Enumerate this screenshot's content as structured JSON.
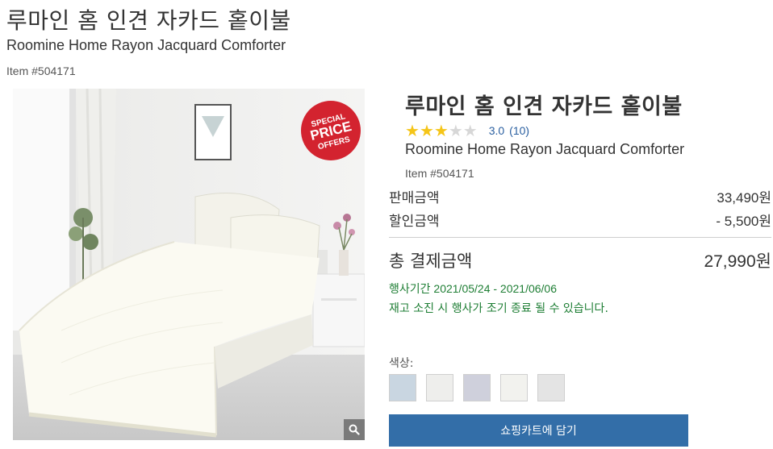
{
  "header": {
    "title": "루마인 홈 인견 자카드 홑이불",
    "subtitle": "Roomine Home Rayon Jacquard Comforter",
    "item_number": "Item #504171"
  },
  "image": {
    "badge_line1": "SPECIAL",
    "badge_line2": "PRICE",
    "badge_line3": "OFFERS",
    "zoom_icon": "magnifier-icon"
  },
  "product": {
    "title": "루마인 홈 인견 자카드 홑이불",
    "rating_value": 3.0,
    "rating_score_text": "3.0",
    "rating_count_text": "(10)",
    "subtitle": "Roomine Home Rayon Jacquard Comforter",
    "item_number": "Item #504171"
  },
  "pricing": {
    "sale_label": "판매금액",
    "sale_value": "33,490원",
    "discount_label": "할인금액",
    "discount_value": "- 5,500원",
    "total_label": "총 결제금액",
    "total_value": "27,990원"
  },
  "event": {
    "period": "행사기간 2021/05/24 - 2021/06/06",
    "note": "재고 소진 시 행사가 조기 종료 될 수 있습니다."
  },
  "colors": {
    "label": "색상:",
    "swatches": [
      "#c9d6e1",
      "#eeeeec",
      "#cfd0dc",
      "#f2f2ee",
      "#e4e4e4"
    ]
  },
  "cart": {
    "button_label": "쇼핑카트에 담기",
    "button_color": "#336ea8"
  }
}
